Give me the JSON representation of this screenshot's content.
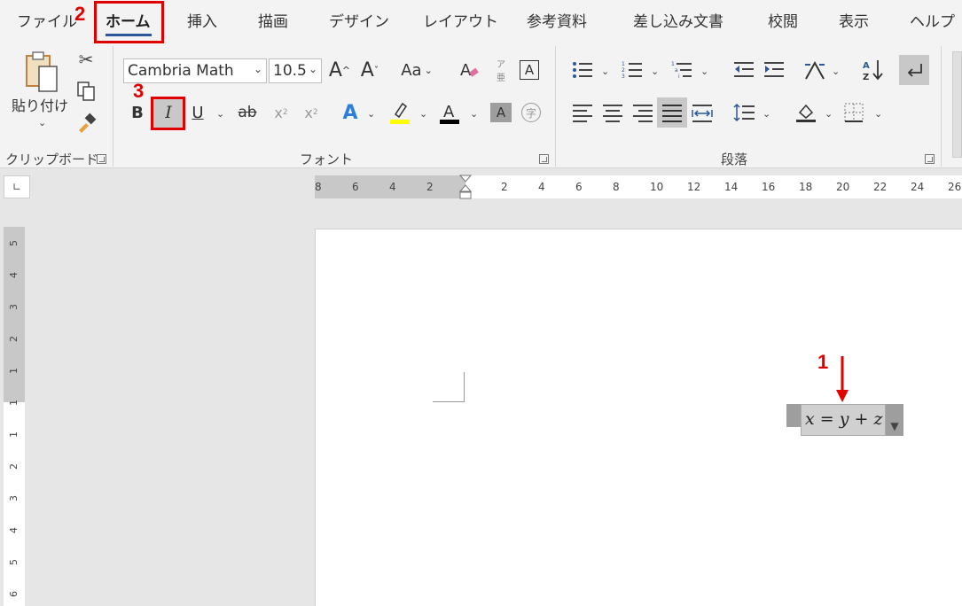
{
  "tabs": [
    {
      "label": "ファイル"
    },
    {
      "label": "ホーム"
    },
    {
      "label": "挿入"
    },
    {
      "label": "描画"
    },
    {
      "label": "デザイン"
    },
    {
      "label": "レイアウト"
    },
    {
      "label": "参考資料"
    },
    {
      "label": "差し込み文書"
    },
    {
      "label": "校閲"
    },
    {
      "label": "表示"
    },
    {
      "label": "ヘルプ"
    }
  ],
  "clipboard": {
    "paste_label": "貼り付け",
    "group_label": "クリップボード"
  },
  "font": {
    "font_name": "Cambria Math",
    "font_size": "10.5",
    "group_label": "フォント",
    "case_label": "Aa",
    "bold_label": "B",
    "italic_label": "I",
    "underline_label": "U",
    "strike_label": "ab",
    "subscript_label": "x",
    "superscript_label": "x"
  },
  "paragraph": {
    "group_label": "段落"
  },
  "ruler": {
    "h_numbers": [
      "8",
      "6",
      "4",
      "2",
      "2",
      "4",
      "6",
      "8",
      "10",
      "12",
      "14",
      "16",
      "18",
      "20",
      "22",
      "24",
      "26"
    ],
    "v_numbers": [
      "5",
      "4",
      "3",
      "2",
      "1",
      "1",
      "1",
      "2",
      "3",
      "4",
      "5",
      "6"
    ]
  },
  "document": {
    "equation": "x = y + z"
  },
  "annotations": {
    "step1": "1",
    "step2": "2",
    "step3": "3"
  },
  "colors": {
    "accent": "#2b579a",
    "annotation": "#e00000",
    "highlight": "#ffff00"
  }
}
